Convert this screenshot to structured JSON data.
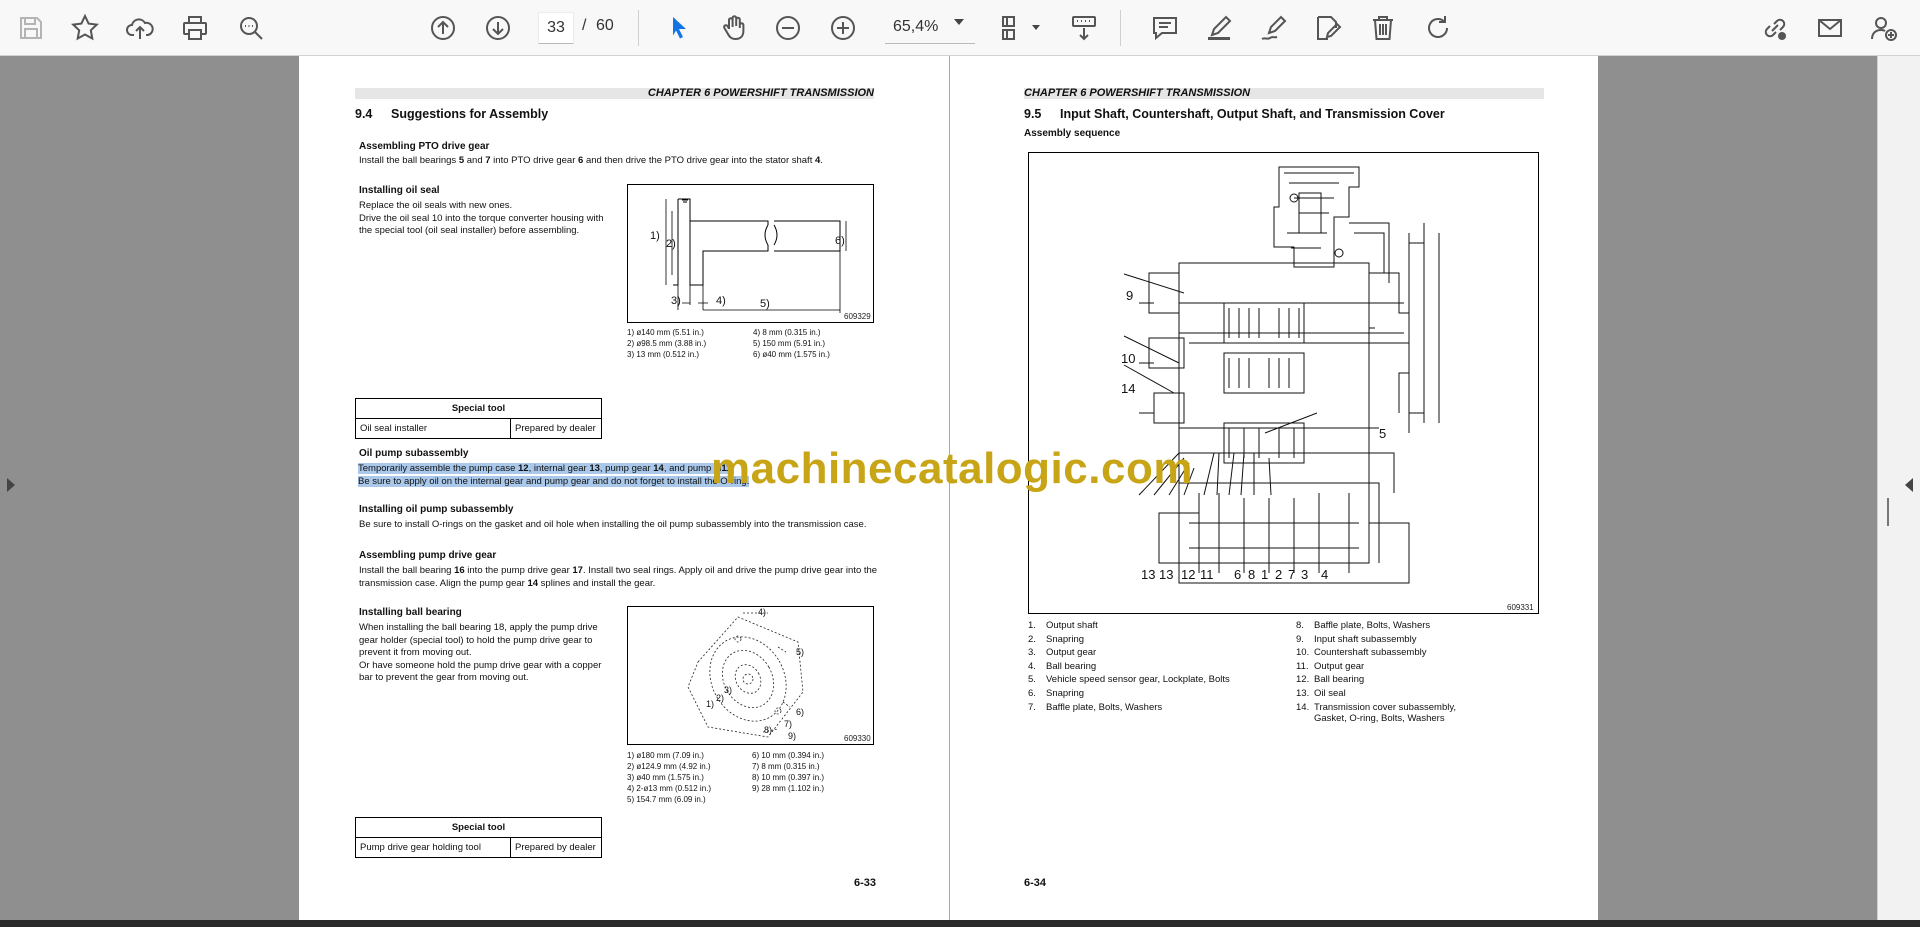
{
  "toolbar": {
    "page_current": "33",
    "page_separator": "/",
    "page_total": "60",
    "zoom": "65,4%"
  },
  "icons": [
    "save-icon",
    "bookmark-star-icon",
    "cloud-upload-icon",
    "print-icon",
    "zoom-search-icon",
    "page-up-icon",
    "page-down-icon",
    "select-cursor-icon",
    "hand-tool-icon",
    "zoom-out-icon",
    "zoom-in-icon",
    "fit-page-icon",
    "scroll-mode-icon",
    "comment-icon",
    "highlight-pen-icon",
    "draw-icon",
    "edit-text-icon",
    "delete-icon",
    "rotate-icon",
    "share-link-icon",
    "email-icon",
    "add-user-icon"
  ],
  "left_page": {
    "chapter": "CHAPTER 6 POWERSHIFT TRANSMISSION",
    "section_number": "9.4",
    "section_title": "Suggestions for Assembly",
    "pto": {
      "heading": "Assembling PTO drive gear",
      "parts": [
        "Install the ball bearings ",
        "5",
        " and ",
        "7",
        " into PTO drive gear ",
        "6",
        " and then drive the PTO drive gear into the stator shaft ",
        "4",
        "."
      ]
    },
    "oil_seal": {
      "heading": "Installing oil seal",
      "lines": [
        "Replace the oil seals with new ones.",
        "Drive the oil seal 10 into the torque converter housing with",
        "the special tool (oil seal installer) before assembling."
      ]
    },
    "fig1": {
      "number": "609329",
      "labels": [
        "1)",
        "2)",
        "3)",
        "4)",
        "5)",
        "6)"
      ],
      "legend_left": [
        "1)  ø140 mm (5.51 in.)",
        "2)  ø98.5 mm (3.88 in.)",
        "3)  13 mm (0.512 in.)"
      ],
      "legend_right": [
        "4)  8 mm (0.315 in.)",
        "5)  150 mm (5.91 in.)",
        "6)  ø40 mm (1.575 in.)"
      ]
    },
    "table1": {
      "header": "Special tool",
      "col1": "Oil seal installer",
      "col2": "Prepared by dealer"
    },
    "oil_pump": {
      "heading": "Oil pump subassembly",
      "line1_parts": [
        "Temporarily assemble the pump case ",
        "12",
        ", internal gear ",
        "13",
        ", pump gear ",
        "14",
        ", and pump pl",
        "11",
        "."
      ],
      "line2": "Be sure to apply oil on the internal gear and pump gear and do not forget to install the O-ring."
    },
    "install_pump": {
      "heading": "Installing oil pump subassembly",
      "text": "Be sure to install O-rings on the gasket and oil hole when installing the oil pump subassembly into the transmission case."
    },
    "pump_drive": {
      "heading": "Assembling pump drive gear",
      "line1_parts": [
        "Install the ball bearing ",
        "16",
        " into the pump drive gear ",
        "17",
        ". Install two seal rings. Apply oil and drive the pump drive gear into the"
      ],
      "line2_parts": [
        "transmission case. Align the pump gear ",
        "14",
        " splines and install the gear."
      ]
    },
    "ball_bearing": {
      "heading": "Installing ball bearing",
      "lines": [
        "When installing the ball bearing 18, apply the pump drive",
        "gear holder (special tool) to hold the pump drive gear to",
        "prevent it from moving out.",
        "Or have someone hold the pump drive gear with a copper",
        "bar to prevent the gear from moving out."
      ]
    },
    "fig2": {
      "number": "609330",
      "labels": [
        "1)",
        "2)",
        "3)",
        "4)",
        "5)",
        "6)",
        "7)",
        "8)",
        "9)"
      ],
      "legend_left": [
        "1)  ø180 mm (7.09 in.)",
        "2)  ø124.9 mm (4.92 in.)",
        "3)  ø40 mm (1.575 in.)",
        "4)  2-ø13 mm (0.512 in.)",
        "5)  154.7 mm (6.09 in.)"
      ],
      "legend_right": [
        "6)  10 mm (0.394 in.)",
        "7)  8 mm (0.315 in.)",
        "8)  10 mm (0.397 in.)",
        "9)  28 mm (1.102 in.)"
      ]
    },
    "table2": {
      "header": "Special tool",
      "col1": "Pump drive gear holding tool",
      "col2": "Prepared by dealer"
    },
    "folio": "6-33"
  },
  "right_page": {
    "chapter": "CHAPTER 6 POWERSHIFT TRANSMISSION",
    "section_number": "9.5",
    "section_title": "Input Shaft, Countershaft, Output Shaft, and Transmission Cover",
    "subheading": "Assembly sequence",
    "figure_number": "609331",
    "callouts": [
      "9",
      "10",
      "14",
      "5",
      "13",
      "13",
      "12",
      "11",
      "6",
      "8",
      "1",
      "2",
      "7",
      "3",
      "4"
    ],
    "list_left": [
      {
        "n": "1.",
        "t": "Output shaft"
      },
      {
        "n": "2.",
        "t": "Snapring"
      },
      {
        "n": "3.",
        "t": "Output gear"
      },
      {
        "n": "4.",
        "t": "Ball bearing"
      },
      {
        "n": "5.",
        "t": "Vehicle speed sensor gear, Lockplate, Bolts"
      },
      {
        "n": "6.",
        "t": "Snapring"
      },
      {
        "n": "7.",
        "t": "Baffle plate, Bolts, Washers"
      }
    ],
    "list_right": [
      {
        "n": "8.",
        "t": "Baffle plate, Bolts, Washers"
      },
      {
        "n": "9.",
        "t": "Input shaft subassembly"
      },
      {
        "n": "10.",
        "t": "Countershaft subassembly"
      },
      {
        "n": "11.",
        "t": "Output gear"
      },
      {
        "n": "12.",
        "t": "Ball bearing"
      },
      {
        "n": "13.",
        "t": "Oil seal"
      },
      {
        "n": "14.",
        "t": "Transmission cover subassembly,"
      }
    ],
    "list_right_cont": "Gasket, O-ring, Bolts, Washers",
    "folio": "6-34"
  },
  "watermark": "machinecatalogic.com"
}
